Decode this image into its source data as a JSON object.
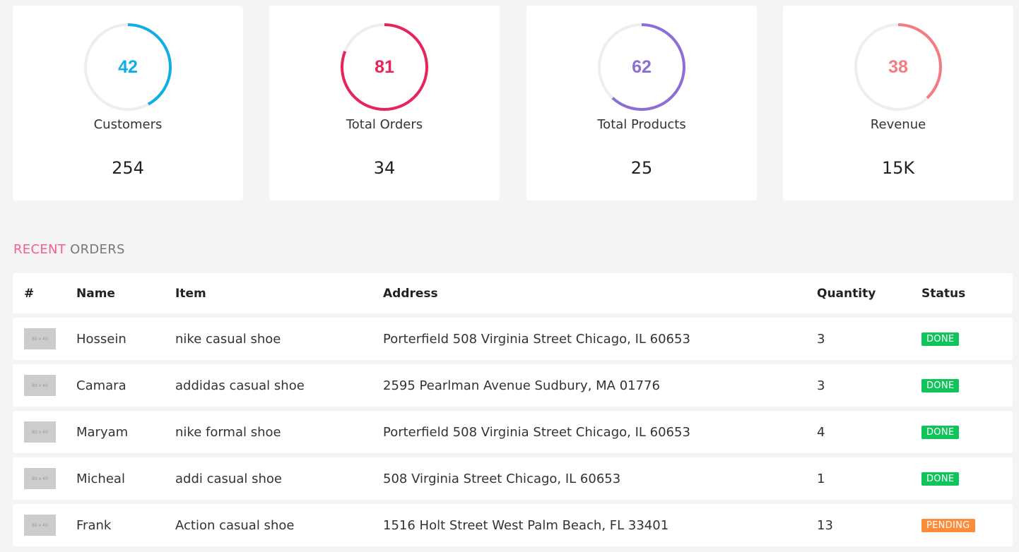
{
  "stats": [
    {
      "pct": 42,
      "label": "Customers",
      "value": "254",
      "color": "#10aee8"
    },
    {
      "pct": 81,
      "label": "Total Orders",
      "value": "34",
      "color": "#e8245a"
    },
    {
      "pct": 62,
      "label": "Total Products",
      "value": "25",
      "color": "#8b6fd6"
    },
    {
      "pct": 38,
      "label": "Revenue",
      "value": "15K",
      "color": "#f57a82"
    }
  ],
  "ring_track_color": "#eeeeee",
  "section": {
    "accent": "RECENT",
    "rest": "ORDERS",
    "accent_color": "#f06292"
  },
  "table": {
    "headers": {
      "idx": "#",
      "name": "Name",
      "item": "Item",
      "address": "Address",
      "quantity": "Quantity",
      "status": "Status"
    },
    "rows": [
      {
        "thumb": "80 x 40",
        "name": "Hossein",
        "item": "nike casual shoe",
        "address": "Porterfield 508 Virginia Street Chicago, IL 60653",
        "quantity": "3",
        "status": "DONE",
        "status_color": "#10c45c"
      },
      {
        "thumb": "80 x 40",
        "name": "Camara",
        "item": "addidas casual shoe",
        "address": "2595 Pearlman Avenue Sudbury, MA 01776",
        "quantity": "3",
        "status": "DONE",
        "status_color": "#10c45c"
      },
      {
        "thumb": "80 x 40",
        "name": "Maryam",
        "item": "nike formal shoe",
        "address": "Porterfield 508 Virginia Street Chicago, IL 60653",
        "quantity": "4",
        "status": "DONE",
        "status_color": "#10c45c"
      },
      {
        "thumb": "80 x 40",
        "name": "Micheal",
        "item": "addi casual shoe",
        "address": "508 Virginia Street Chicago, IL 60653",
        "quantity": "1",
        "status": "DONE",
        "status_color": "#10c45c"
      },
      {
        "thumb": "80 x 40",
        "name": "Frank",
        "item": "Action casual shoe",
        "address": "1516 Holt Street West Palm Beach, FL 33401",
        "quantity": "13",
        "status": "PENDING",
        "status_color": "#fb8c3c"
      }
    ]
  }
}
